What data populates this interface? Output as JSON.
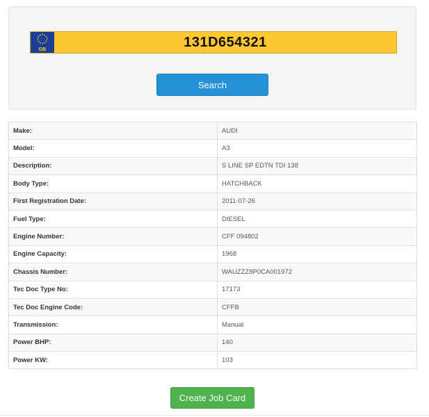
{
  "search": {
    "plate_country": "GB",
    "plate_number": "131D654321",
    "button_label": "Search",
    "plate_color": "#fdc830",
    "eu_band_color": "#1e3d96",
    "icon": "eu-stars-icon"
  },
  "details": {
    "rows": [
      {
        "label": "Make:",
        "value": "AUDI"
      },
      {
        "label": "Model:",
        "value": "A3"
      },
      {
        "label": "Description:",
        "value": "S LINE SP EDTN TDI 138"
      },
      {
        "label": "Body Type:",
        "value": "HATCHBACK"
      },
      {
        "label": "First Registration Date:",
        "value": "2011-07-26"
      },
      {
        "label": "Fuel Type:",
        "value": "DIESEL"
      },
      {
        "label": "Engine Number:",
        "value": "CFF 094802"
      },
      {
        "label": "Engine Capacity:",
        "value": "1968"
      },
      {
        "label": "Chassis Number:",
        "value": "WAUZZZ8P0CA001972"
      },
      {
        "label": "Tec Doc Type No:",
        "value": "17173"
      },
      {
        "label": "Tec Doc Engine Code:",
        "value": "CFFB"
      },
      {
        "label": "Transmission:",
        "value": "Manual"
      },
      {
        "label": "Power BHP:",
        "value": "140"
      },
      {
        "label": "Power KW:",
        "value": "103"
      }
    ]
  },
  "actions": {
    "create_job_card_label": "Create Job Card",
    "create_color": "#4fb24c",
    "search_color": "#2490d6"
  }
}
